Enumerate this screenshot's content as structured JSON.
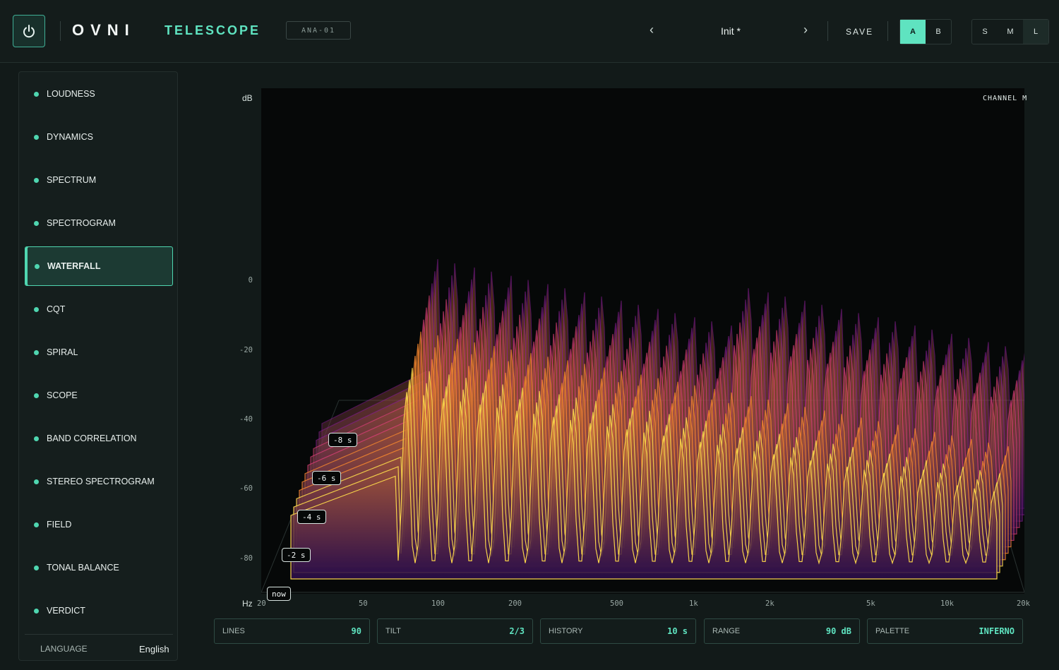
{
  "header": {
    "brand": "OVNI",
    "product": "TELESCOPE",
    "model": "ANA-01",
    "prev_arrow": "‹",
    "next_arrow": "›",
    "preset": "Init *",
    "save_label": "SAVE",
    "ab": [
      "A",
      "B"
    ],
    "ab_selected": "A",
    "sizes": [
      "S",
      "M",
      "L"
    ],
    "size_selected": "L",
    "icons": {
      "power": "power-icon"
    }
  },
  "sidebar": {
    "items": [
      {
        "label": "LOUDNESS"
      },
      {
        "label": "DYNAMICS"
      },
      {
        "label": "SPECTRUM"
      },
      {
        "label": "SPECTROGRAM"
      },
      {
        "label": "WATERFALL"
      },
      {
        "label": "CQT"
      },
      {
        "label": "SPIRAL"
      },
      {
        "label": "SCOPE"
      },
      {
        "label": "BAND CORRELATION"
      },
      {
        "label": "STEREO SPECTROGRAM"
      },
      {
        "label": "FIELD"
      },
      {
        "label": "TONAL BALANCE"
      },
      {
        "label": "VERDICT"
      }
    ],
    "active": "WATERFALL",
    "language_label": "LANGUAGE",
    "language_value": "English"
  },
  "plot": {
    "y_unit": "dB",
    "x_unit": "Hz",
    "channel": "CHANNEL M",
    "y_ticks": [
      "0",
      "-20",
      "-40",
      "-60",
      "-80"
    ],
    "x_ticks": [
      "20",
      "50",
      "100",
      "200",
      "500",
      "1k",
      "2k",
      "5k",
      "10k",
      "20k"
    ],
    "time_labels": [
      "-8 s",
      "-6 s",
      "-4 s",
      "-2 s",
      "now"
    ],
    "palette_colors": [
      "#2a0d4a",
      "#8f1f9a",
      "#e0407a",
      "#f5872e",
      "#f7d24a"
    ]
  },
  "params": [
    {
      "label": "LINES",
      "value": "90"
    },
    {
      "label": "TILT",
      "value": "2/3"
    },
    {
      "label": "HISTORY",
      "value": "10 s"
    },
    {
      "label": "RANGE",
      "value": "90 dB"
    },
    {
      "label": "PALETTE",
      "value": "INFERNO"
    }
  ]
}
